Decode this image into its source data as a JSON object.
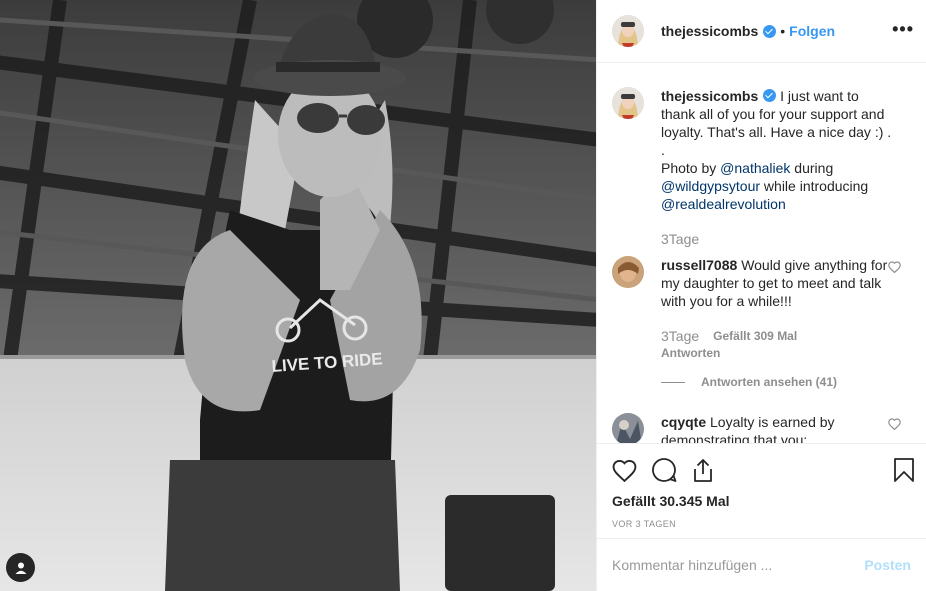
{
  "post": {
    "username": "thejessicombs",
    "follow_label": "Folgen",
    "separator": "•",
    "more_label": "•••"
  },
  "caption": {
    "username": "thejessicombs",
    "text_1": "I just want to thank all of you for your support and loyalty. That's all. Have a nice day :) .",
    "dot_line": ".",
    "photo_by": "Photo by ",
    "mention_1": "@nathaliek",
    "during": " during",
    "mention_2": "@wildgypsytour",
    "introducing": " while introducing",
    "mention_3": "@realdealrevolution",
    "age": "3Tage"
  },
  "comments": [
    {
      "username": "russell7088",
      "text": "Would give anything for my daughter to get to meet and talk with you for a while!!!",
      "age": "3Tage",
      "likes": "Gefällt 309 Mal",
      "reply_label": "Antworten",
      "view_replies": "Antworten ansehen (41)"
    },
    {
      "username": "cqyqte",
      "text": "Loyalty is earned by demonstrating that you:"
    }
  ],
  "stats": {
    "likes": "Gefällt 30.345 Mal",
    "date": "VOR 3 TAGEN"
  },
  "add_comment": {
    "placeholder": "Kommentar hinzufügen ...",
    "post_label": "Posten"
  },
  "icons": {
    "verified": "verified-badge-icon",
    "like": "heart-icon",
    "comment": "comment-bubble-icon",
    "share": "share-icon",
    "save": "bookmark-icon",
    "tag": "user-tag-icon"
  },
  "colors": {
    "accent": "#3897f0",
    "link": "#003569",
    "muted": "#8e8e8e",
    "post_disabled": "#b2dffc"
  },
  "photo_shirt_text": "LIVE TO RIDE"
}
